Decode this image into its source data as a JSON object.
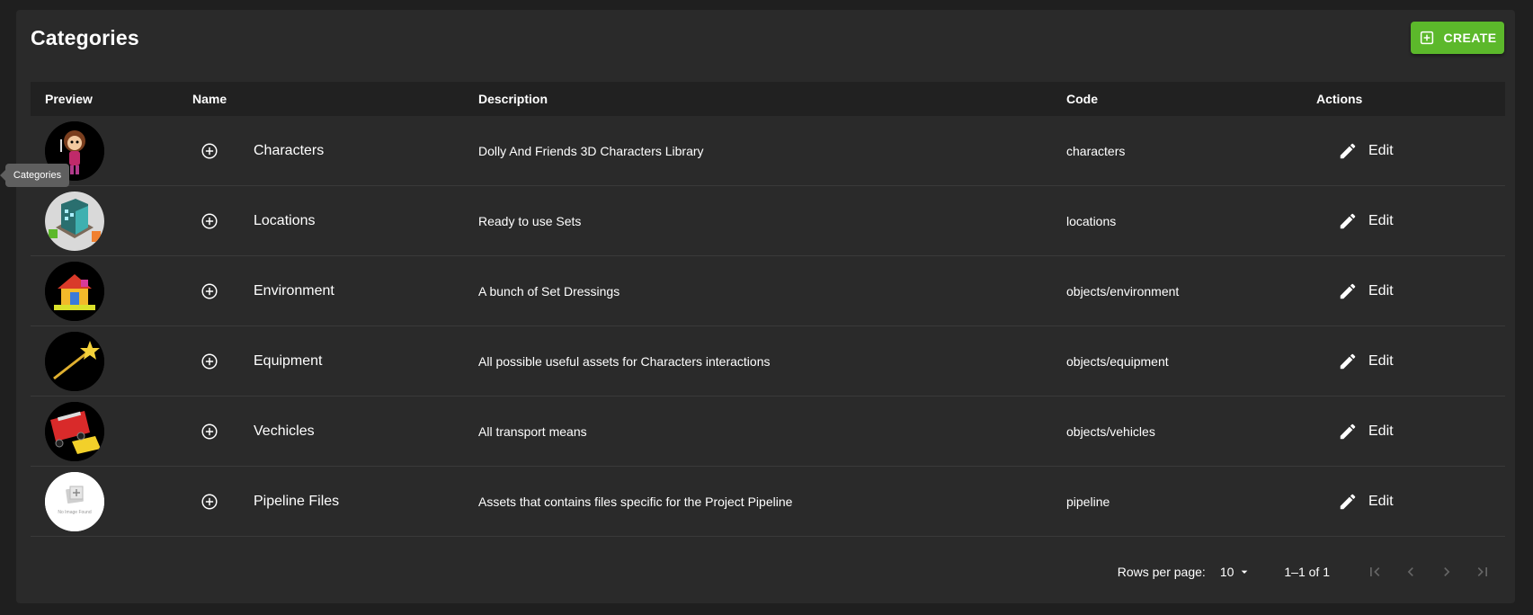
{
  "page": {
    "title": "Categories",
    "create_label": "CREATE"
  },
  "colors": {
    "accent": "#5cb82b",
    "panel": "#2a2a2a",
    "header": "#212121"
  },
  "table": {
    "headers": {
      "preview": "Preview",
      "name": "Name",
      "description": "Description",
      "code": "Code",
      "actions": "Actions"
    },
    "edit_label": "Edit",
    "rows": [
      {
        "name": "Characters",
        "description": "Dolly And Friends 3D Characters Library",
        "code": "characters",
        "preview": "character-thumbnail"
      },
      {
        "name": "Locations",
        "description": "Ready to use Sets",
        "code": "locations",
        "preview": "building-thumbnail"
      },
      {
        "name": "Environment",
        "description": "A bunch of Set Dressings",
        "code": "objects/environment",
        "preview": "playhouse-thumbnail"
      },
      {
        "name": "Equipment",
        "description": "All possible useful assets for Characters interactions",
        "code": "objects/equipment",
        "preview": "magic-wand-thumbnail"
      },
      {
        "name": "Vechicles",
        "description": "All transport means",
        "code": "objects/vehicles",
        "preview": "firetruck-thumbnail"
      },
      {
        "name": "Pipeline Files",
        "description": "Assets that contains files specific for the Project Pipeline",
        "code": "pipeline",
        "preview": "no-image-thumbnail",
        "preview_text": "No Image Found"
      }
    ]
  },
  "pagination": {
    "rows_per_page_label": "Rows per page:",
    "rows_per_page": "10",
    "range": "1–1 of 1"
  },
  "tooltip": {
    "text": "Categories"
  }
}
